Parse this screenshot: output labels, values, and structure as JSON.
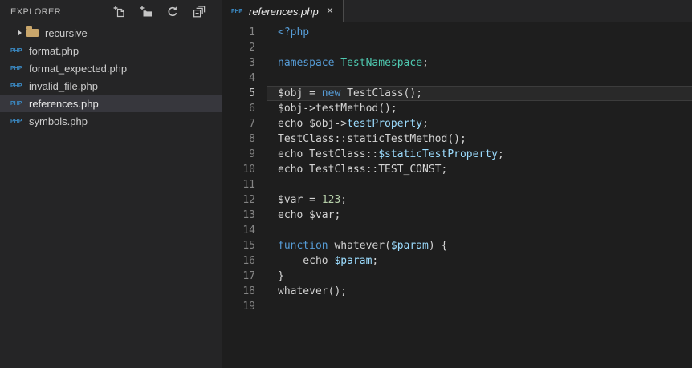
{
  "colors": {
    "editor_bg": "#1e1e1e",
    "sidebar_bg": "#252526",
    "selected_item_bg": "#37373d",
    "tab_border": "#4b4b4b",
    "default_text": "#d4d4d4",
    "keyword": "#569cd6",
    "class_name": "#4ec9b0",
    "property": "#9cdcfe",
    "number": "#b5cea8",
    "line_number": "#858585",
    "line_number_active": "#c6c6c6",
    "icon": "#c5c5c5",
    "php_icon_blue": "#3b8bc6",
    "folder_tan": "#c9a66b"
  },
  "sidebar": {
    "title": "EXPLORER",
    "actions": [
      "new-file",
      "new-folder",
      "refresh",
      "collapse-all"
    ],
    "tree": [
      {
        "type": "folder",
        "label": "recursive",
        "collapsed": true,
        "selected": false
      },
      {
        "type": "file",
        "label": "format.php",
        "icon": "PHP",
        "selected": false
      },
      {
        "type": "file",
        "label": "format_expected.php",
        "icon": "PHP",
        "selected": false
      },
      {
        "type": "file",
        "label": "invalid_file.php",
        "icon": "PHP",
        "selected": false
      },
      {
        "type": "file",
        "label": "references.php",
        "icon": "PHP",
        "selected": true
      },
      {
        "type": "file",
        "label": "symbols.php",
        "icon": "PHP",
        "selected": false
      }
    ]
  },
  "tab": {
    "label": "references.php",
    "icon": "PHP",
    "close_glyph": "✕",
    "preview_italic": true
  },
  "editor": {
    "current_line": 5,
    "lines": [
      {
        "n": 1,
        "segs": [
          [
            "<?php",
            "k"
          ]
        ]
      },
      {
        "n": 2,
        "segs": []
      },
      {
        "n": 3,
        "segs": [
          [
            "namespace",
            "k"
          ],
          [
            " ",
            "d"
          ],
          [
            "TestNamespace",
            "t"
          ],
          [
            ";",
            "d"
          ]
        ]
      },
      {
        "n": 4,
        "segs": []
      },
      {
        "n": 5,
        "segs": [
          [
            "$obj = ",
            "d"
          ],
          [
            "new",
            "k"
          ],
          [
            " TestClass();",
            "d"
          ]
        ]
      },
      {
        "n": 6,
        "segs": [
          [
            "$obj->testMethod();",
            "d"
          ]
        ]
      },
      {
        "n": 7,
        "segs": [
          [
            "echo $obj->",
            "d"
          ],
          [
            "testProperty",
            "p"
          ],
          [
            ";",
            "d"
          ]
        ]
      },
      {
        "n": 8,
        "segs": [
          [
            "TestClass::staticTestMethod();",
            "d"
          ]
        ]
      },
      {
        "n": 9,
        "segs": [
          [
            "echo TestClass::",
            "d"
          ],
          [
            "$staticTestProperty",
            "p"
          ],
          [
            ";",
            "d"
          ]
        ]
      },
      {
        "n": 10,
        "segs": [
          [
            "echo TestClass::TEST_CONST;",
            "d"
          ]
        ]
      },
      {
        "n": 11,
        "segs": []
      },
      {
        "n": 12,
        "segs": [
          [
            "$var = ",
            "d"
          ],
          [
            "123",
            "n"
          ],
          [
            ";",
            "d"
          ]
        ]
      },
      {
        "n": 13,
        "segs": [
          [
            "echo $var;",
            "d"
          ]
        ]
      },
      {
        "n": 14,
        "segs": []
      },
      {
        "n": 15,
        "segs": [
          [
            "function",
            "k"
          ],
          [
            " whatever(",
            "d"
          ],
          [
            "$param",
            "p"
          ],
          [
            ") {",
            "d"
          ]
        ]
      },
      {
        "n": 16,
        "segs": [
          [
            "    echo ",
            "d"
          ],
          [
            "$param",
            "p"
          ],
          [
            ";",
            "d"
          ]
        ]
      },
      {
        "n": 17,
        "segs": [
          [
            "}",
            "d"
          ]
        ]
      },
      {
        "n": 18,
        "segs": [
          [
            "whatever();",
            "d"
          ]
        ]
      },
      {
        "n": 19,
        "segs": []
      }
    ]
  }
}
